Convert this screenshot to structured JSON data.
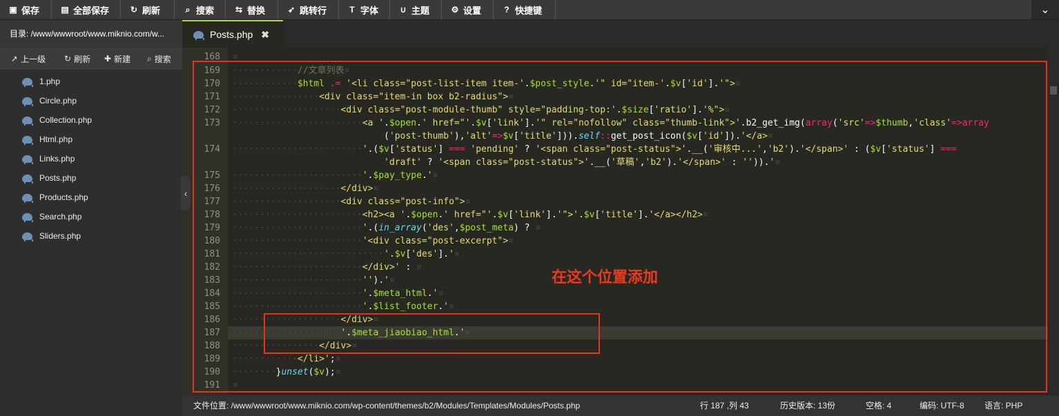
{
  "toolbar": {
    "save": "保存",
    "save_all": "全部保存",
    "refresh": "刷新",
    "search": "搜索",
    "replace": "替换",
    "goto_line": "跳转行",
    "font": "字体",
    "theme": "主题",
    "settings": "设置",
    "shortcuts": "快捷键"
  },
  "left_panel": {
    "directory_label": "目录: /www/wwwroot/www.miknio.com/w...",
    "actions": {
      "up": "上一级",
      "refresh": "刷新",
      "new": "新建",
      "search": "搜索"
    },
    "files": [
      "1.php",
      "Circle.php",
      "Collection.php",
      "Html.php",
      "Links.php",
      "Posts.php",
      "Products.php",
      "Search.php",
      "Sliders.php"
    ]
  },
  "tab": {
    "name": "Posts.php",
    "close": "✖"
  },
  "editor": {
    "line_numbers": [
      "168",
      "169",
      "170",
      "171",
      "172",
      "173",
      "",
      "174",
      "",
      "175",
      "176",
      "177",
      "178",
      "179",
      "180",
      "181",
      "182",
      "183",
      "184",
      "185",
      "186",
      "187",
      "188",
      "189",
      "190",
      "191"
    ],
    "highlight_line": "187"
  },
  "annotation": {
    "text": "在这个位置添加",
    "color": "#e8341c"
  },
  "status_bar": {
    "file_path": "文件位置: /www/wwwroot/www.miknio.com/wp-content/themes/b2/Modules/Templates/Modules/Posts.php",
    "cursor": "行 187 ,列 43",
    "history": "历史版本: 13份",
    "spaces": "空格: 4",
    "encoding": "编码: UTF-8",
    "language": "语言: PHP"
  },
  "colors": {
    "editor_bg": "#272822",
    "comment": "#75715e",
    "keyword": "#f92672",
    "string": "#e6db74",
    "variable": "#a6e22e",
    "builtin": "#66d9ef"
  }
}
